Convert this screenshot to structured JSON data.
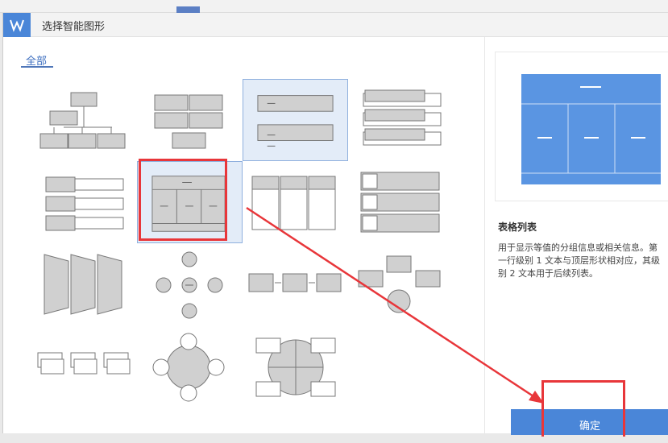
{
  "dialog": {
    "title": "选择智能图形",
    "logo": "W"
  },
  "categories": [
    {
      "label": "全部"
    }
  ],
  "thumbnails": [
    {
      "name": "org-chart"
    },
    {
      "name": "block-grid"
    },
    {
      "name": "stacked-list"
    },
    {
      "name": "tab-list"
    },
    {
      "name": "bullet-list"
    },
    {
      "name": "table-list"
    },
    {
      "name": "column-list"
    },
    {
      "name": "picture-list"
    },
    {
      "name": "trapezoid-list"
    },
    {
      "name": "radial-arrows"
    },
    {
      "name": "process"
    },
    {
      "name": "converging"
    },
    {
      "name": "step-process"
    },
    {
      "name": "radial-cycle"
    },
    {
      "name": "circle-matrix"
    }
  ],
  "details": {
    "title": "表格列表",
    "desc_lines": [
      "用于显示等值的分组信息或相关信息。第",
      "一行级别 1 文本与顶层形状相对应，其级",
      "别 2 文本用于后续列表。"
    ]
  },
  "buttons": {
    "ok": "确定"
  },
  "colors": {
    "accent": "#4a86d8",
    "annotation": "#e8363a"
  }
}
